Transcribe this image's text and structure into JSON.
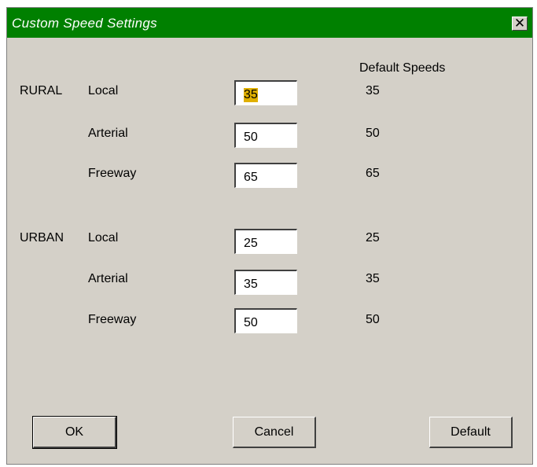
{
  "window": {
    "title": "Custom Speed Settings",
    "close_glyph": "✕",
    "close_icon": "close-icon"
  },
  "columns": {
    "default_header": "Default Speeds"
  },
  "rural": {
    "group_label": "RURAL",
    "local": {
      "label": "Local",
      "value": "35",
      "default": "35"
    },
    "arterial": {
      "label": "Arterial",
      "value": "50",
      "default": "50"
    },
    "freeway": {
      "label": "Freeway",
      "value": "65",
      "default": "65"
    }
  },
  "urban": {
    "group_label": "URBAN",
    "local": {
      "label": "Local",
      "value": "25",
      "default": "25"
    },
    "arterial": {
      "label": "Arterial",
      "value": "35",
      "default": "35"
    },
    "freeway": {
      "label": "Freeway",
      "value": "50",
      "default": "50"
    }
  },
  "buttons": {
    "ok": "OK",
    "cancel": "Cancel",
    "default": "Default"
  },
  "colors": {
    "titlebar": "#008000",
    "selection_highlight": "#e0b000",
    "dialog_face": "#d4d0c8"
  }
}
